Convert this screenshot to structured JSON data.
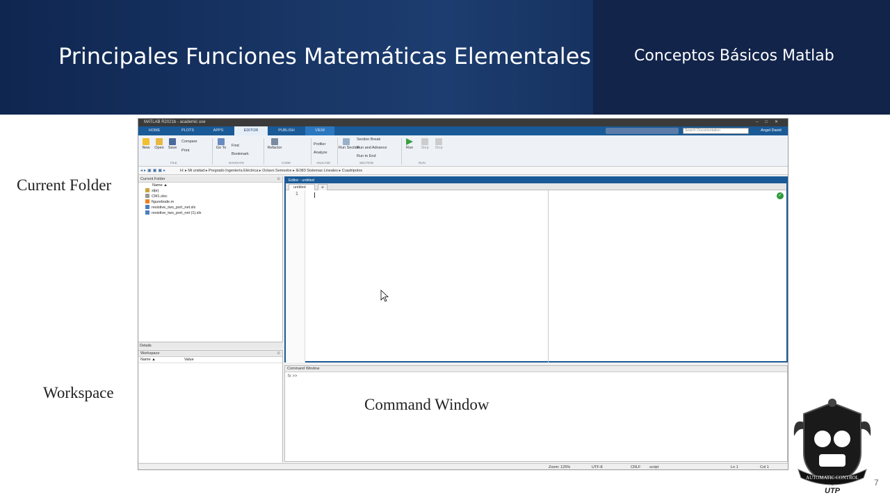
{
  "slide": {
    "title": "Principales Funciones Matemáticas Elementales",
    "subtitle": "Conceptos Básicos Matlab",
    "labels": {
      "current_folder": "Current Folder",
      "workspace": "Workspace",
      "command_window": "Command Window"
    },
    "page_number": "7",
    "logo_text": "AUTOMATIC CONTROL",
    "logo_brand": "UTP"
  },
  "matlab": {
    "window_title": "MATLAB R2021b - academic use",
    "tabs": [
      "HOME",
      "PLOTS",
      "APPS",
      "EDITOR",
      "PUBLISH",
      "VIEW"
    ],
    "active_tab": "EDITOR",
    "search_placeholder": "Search Documentation",
    "user": "Angel David",
    "toolstrip": {
      "new": "New",
      "open": "Open",
      "save": "Save",
      "compare": "Compare",
      "print": "Print",
      "goto": "Go To",
      "find": "Find",
      "bookmark": "Bookmark",
      "refactor": "Refactor",
      "profiler": "Profiler",
      "analyze": "Analyze",
      "run_section": "Run Section",
      "section_break": "Section Break",
      "run_advance": "Run and Advance",
      "run_end": "Run to End",
      "run": "Run",
      "step": "Step",
      "stop": "Stop",
      "sections": [
        "FILE",
        "NAVIGATE",
        "CODE",
        "ANALYZE",
        "SECTION",
        "RUN"
      ]
    },
    "path": [
      "H:",
      "Mi unidad",
      "Pregrado Ingeniería Eléctrica",
      "Octavo Semestre",
      "IE083 Sistemas Lineales",
      "Cuadripolos"
    ],
    "current_folder": {
      "title": "Current Folder",
      "column": "Name ▲",
      "files": [
        {
          "name": "slprj",
          "type": "folder"
        },
        {
          "name": "CM1.slxc",
          "type": "file"
        },
        {
          "name": "figurebode.m",
          "type": "m"
        },
        {
          "name": "resistive_two_port_net.slx",
          "type": "slx"
        },
        {
          "name": "resistive_two_port_net (1).slx",
          "type": "slx"
        }
      ]
    },
    "details": "Details",
    "workspace": {
      "title": "Workspace",
      "col_name": "Name ▲",
      "col_value": "Value"
    },
    "editor": {
      "title": "Editor - untitled",
      "tab": "untitled",
      "line_number": "1"
    },
    "command_window": {
      "title": "Command Window",
      "prompt": "fx  >>"
    },
    "status": {
      "zoom": "Zoom: 125%",
      "encoding": "UTF-8",
      "eol": "CRLF",
      "type": "script",
      "ln": "Ln  1",
      "col": "Col  1"
    }
  },
  "colors": {
    "header_dark": "#0f2650",
    "matlab_blue": "#1a5a96"
  }
}
